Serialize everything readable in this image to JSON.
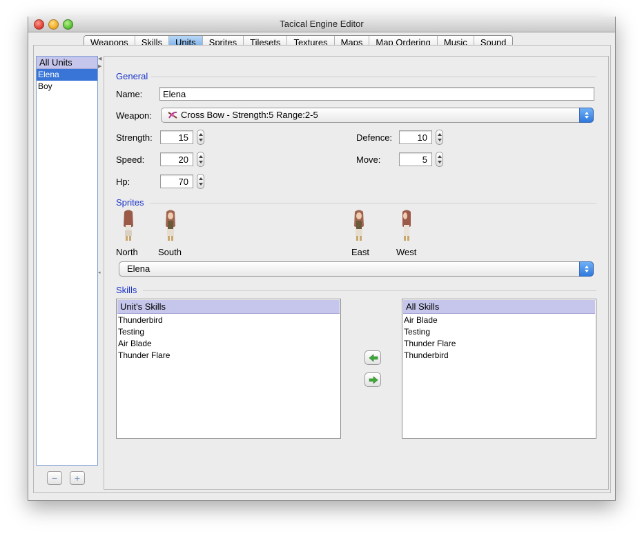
{
  "window": {
    "title": "Tacical Engine Editor"
  },
  "tabs": [
    "Weapons",
    "Skills",
    "Units",
    "Sprites",
    "Tilesets",
    "Textures",
    "Maps",
    "Map Ordering",
    "Music",
    "Sound"
  ],
  "active_tab": "Units",
  "unit_list": {
    "header": "All Units",
    "items": [
      "Elena",
      "Boy"
    ],
    "selected": "Elena",
    "remove_label": "−",
    "add_label": "+"
  },
  "general": {
    "section_title": "General",
    "name_label": "Name:",
    "name_value": "Elena",
    "weapon_label": "Weapon:",
    "weapon_value": "Cross Bow - Strength:5 Range:2-5",
    "strength_label": "Strength:",
    "strength_value": "15",
    "defence_label": "Defence:",
    "defence_value": "10",
    "speed_label": "Speed:",
    "speed_value": "20",
    "move_label": "Move:",
    "move_value": "5",
    "hp_label": "Hp:",
    "hp_value": "70"
  },
  "sprites": {
    "section_title": "Sprites",
    "north_label": "North",
    "south_label": "South",
    "east_label": "East",
    "west_label": "West",
    "selected_sprite": "Elena"
  },
  "skills": {
    "section_title": "Skills",
    "unit_skills_header": "Unit's Skills",
    "unit_skills": [
      "Thunderbird",
      "Testing",
      "Air Blade",
      "Thunder Flare"
    ],
    "all_skills_header": "All Skills",
    "all_skills": [
      "Air Blade",
      "Testing",
      "Thunder Flare",
      "Thunderbird"
    ]
  },
  "colors": {
    "accent_blue": "#1b34c8",
    "selection": "#3875d7",
    "list_header": "#c6c6ec",
    "move_arrow_green": "#3fa83a"
  }
}
